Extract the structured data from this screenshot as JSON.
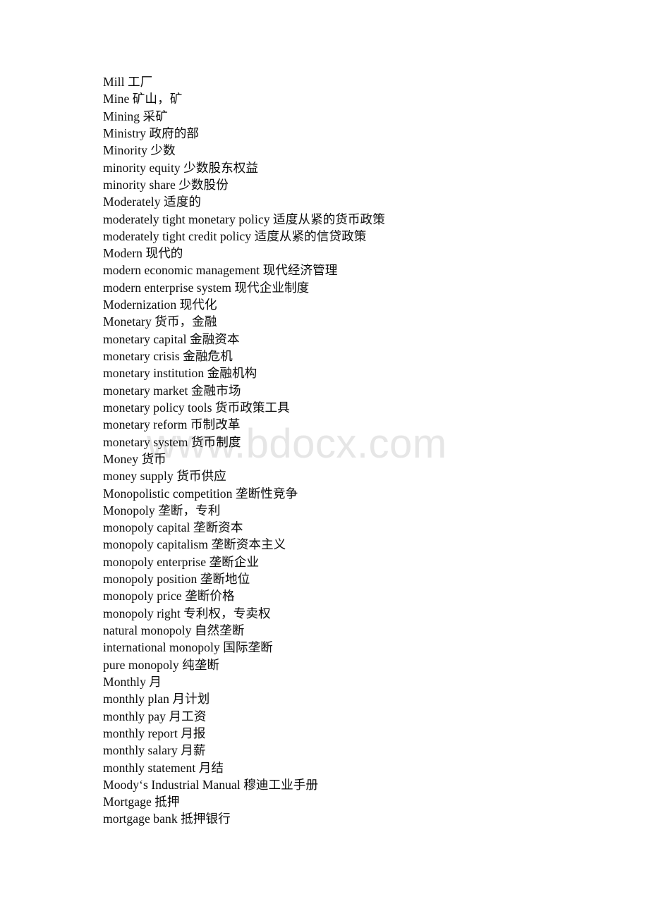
{
  "document": {
    "type": "glossary-page",
    "language_pair": "English-Chinese",
    "subject": "economics and finance terminology",
    "section_letter": "M",
    "watermark": "www.bdocx.com",
    "watermark_color": "#e6e6e6",
    "text_color": "#0c0c0c",
    "background_color": "#ffffff"
  },
  "entries": [
    {
      "term": "Mill",
      "translation": "工厂",
      "line": "Mill 工厂"
    },
    {
      "term": "Mine",
      "translation": "矿山，矿",
      "line": "Mine 矿山，矿"
    },
    {
      "term": "Mining",
      "translation": "采矿",
      "line": "Mining 采矿"
    },
    {
      "term": "Ministry",
      "translation": "政府的部",
      "line": "Ministry 政府的部"
    },
    {
      "term": "Minority",
      "translation": "少数",
      "line": "Minority 少数"
    },
    {
      "term": "minority equity",
      "translation": "少数股东权益",
      "line": "minority equity 少数股东权益"
    },
    {
      "term": "minority share",
      "translation": "少数股份",
      "line": "minority share 少数股份"
    },
    {
      "term": "Moderately",
      "translation": "适度的",
      "line": "Moderately 适度的"
    },
    {
      "term": "moderately tight monetary policy",
      "translation": "适度从紧的货币政策",
      "line": "moderately tight monetary policy 适度从紧的货币政策"
    },
    {
      "term": "moderately tight credit policy",
      "translation": "适度从紧的信贷政策",
      "line": "moderately tight credit policy 适度从紧的信贷政策"
    },
    {
      "term": "Modern",
      "translation": "现代的",
      "line": "Modern 现代的"
    },
    {
      "term": "modern economic management",
      "translation": "现代经济管理",
      "line": "modern economic management 现代经济管理"
    },
    {
      "term": "modern enterprise system",
      "translation": "现代企业制度",
      "line": "modern enterprise system 现代企业制度"
    },
    {
      "term": "Modernization",
      "translation": "现代化",
      "line": "Modernization 现代化"
    },
    {
      "term": "Monetary",
      "translation": "货币，金融",
      "line": "Monetary 货币，金融"
    },
    {
      "term": "monetary capital",
      "translation": "金融资本",
      "line": "monetary capital 金融资本"
    },
    {
      "term": "monetary crisis",
      "translation": "金融危机",
      "line": "monetary crisis 金融危机"
    },
    {
      "term": "monetary institution",
      "translation": "金融机构",
      "line": "monetary institution 金融机构"
    },
    {
      "term": "monetary market",
      "translation": "金融市场",
      "line": "monetary market 金融市场"
    },
    {
      "term": "monetary policy tools",
      "translation": "货币政策工具",
      "line": "monetary policy tools 货币政策工具"
    },
    {
      "term": "monetary reform",
      "translation": "币制改革",
      "line": "monetary reform 币制改革"
    },
    {
      "term": "monetary system",
      "translation": "货币制度",
      "line": "monetary system 货币制度"
    },
    {
      "term": "Money",
      "translation": "货币",
      "line": "Money 货币"
    },
    {
      "term": "money supply",
      "translation": "货币供应",
      "line": "money supply 货币供应"
    },
    {
      "term": "Monopolistic competition",
      "translation": "垄断性竞争",
      "line": "Monopolistic competition 垄断性竞争"
    },
    {
      "term": "Monopoly",
      "translation": "垄断，专利",
      "line": "Monopoly 垄断，专利"
    },
    {
      "term": "monopoly capital",
      "translation": "垄断资本",
      "line": "monopoly capital 垄断资本"
    },
    {
      "term": "monopoly capitalism",
      "translation": "垄断资本主义",
      "line": "monopoly capitalism 垄断资本主义"
    },
    {
      "term": "monopoly enterprise",
      "translation": "垄断企业",
      "line": "monopoly enterprise 垄断企业"
    },
    {
      "term": "monopoly position",
      "translation": "垄断地位",
      "line": "monopoly position 垄断地位"
    },
    {
      "term": "monopoly price",
      "translation": "垄断价格",
      "line": "monopoly price 垄断价格"
    },
    {
      "term": "monopoly right",
      "translation": "专利权，专卖权",
      "line": "monopoly right 专利权，专卖权"
    },
    {
      "term": "natural monopoly",
      "translation": "自然垄断",
      "line": "natural monopoly 自然垄断"
    },
    {
      "term": "international monopoly",
      "translation": "国际垄断",
      "line": "international monopoly 国际垄断"
    },
    {
      "term": "pure monopoly",
      "translation": "纯垄断",
      "line": "pure monopoly 纯垄断"
    },
    {
      "term": "Monthly",
      "translation": "月",
      "line": "Monthly 月"
    },
    {
      "term": "monthly plan",
      "translation": "月计划",
      "line": "monthly plan 月计划"
    },
    {
      "term": "monthly pay",
      "translation": "月工资",
      "line": "monthly pay 月工资"
    },
    {
      "term": "monthly report",
      "translation": "月报",
      "line": "monthly report 月报"
    },
    {
      "term": "monthly salary",
      "translation": "月薪",
      "line": "monthly salary 月薪"
    },
    {
      "term": "monthly statement",
      "translation": "月结",
      "line": "monthly statement 月结"
    },
    {
      "term": "Moody‘s Industrial Manual",
      "translation": "穆迪工业手册",
      "line": "Moody‘s Industrial Manual 穆迪工业手册"
    },
    {
      "term": "Mortgage",
      "translation": "抵押",
      "line": "Mortgage 抵押"
    },
    {
      "term": "mortgage bank",
      "translation": "抵押银行",
      "line": "mortgage bank 抵押银行"
    }
  ]
}
